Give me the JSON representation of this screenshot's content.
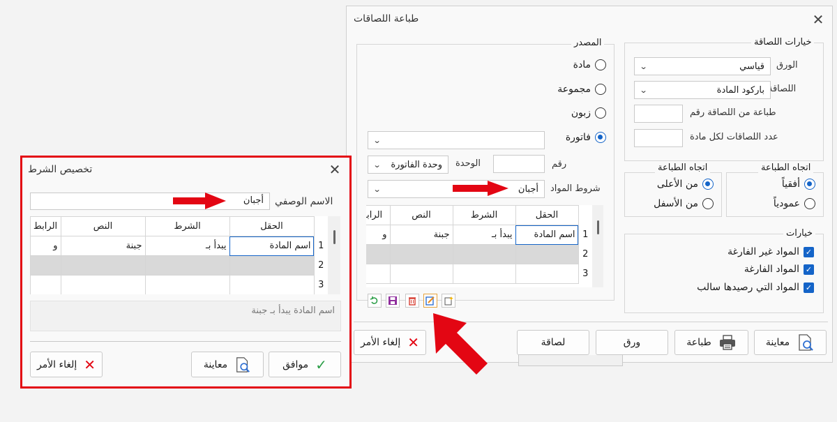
{
  "main": {
    "title": "طباعة اللصاقات",
    "options": {
      "legend": "خيارات اللصاقة",
      "paper_label": "الورق",
      "paper_value": "قياسي",
      "label_label": "اللصاقة",
      "label_value": "باركود المادة",
      "start_label": "طباعة من اللصاقة رقم",
      "count_label": "عدد اللصاقات لكل مادة"
    },
    "source": {
      "legend": "المصدر",
      "options": [
        "مادة",
        "مجموعة",
        "زبون",
        "فاتورة"
      ],
      "number_label": "رقم",
      "unit_label": "الوحدة",
      "unit_value": "وحدة الفاتورة",
      "conditions_label": "شروط المواد",
      "conditions_value": "أجبان"
    },
    "grid": {
      "headers": [
        "الحقل",
        "الشرط",
        "النص",
        "الرابط"
      ],
      "rows": [
        {
          "n": "1",
          "field": "اسم المادة",
          "cond": "يبدأ بـ",
          "text": "جبنة",
          "link": "و"
        },
        {
          "n": "2",
          "field": "",
          "cond": "",
          "text": "",
          "link": ""
        },
        {
          "n": "3",
          "field": "",
          "cond": "",
          "text": "",
          "link": ""
        }
      ]
    },
    "h_direction": {
      "legend": "اتجاه الطباعة",
      "options": [
        "أفقياً",
        "عمودياً"
      ]
    },
    "v_direction": {
      "legend": "اتجاه الطباعة",
      "options": [
        "من الأعلى",
        "من الأسفل"
      ]
    },
    "misc": {
      "legend": "خيارات",
      "options": [
        "المواد غير الفارغة",
        "المواد الفارغة",
        "المواد التي رصيدها سالب"
      ]
    },
    "buttons": {
      "preview": "معاينة",
      "print": "طباعة",
      "paper": "ورق",
      "label": "لصاقة",
      "cancel": "إلغاء الأمر"
    }
  },
  "dialog": {
    "title": "تخصيص الشرط",
    "desc_label": "الاسم الوصفي",
    "desc_value": "أجبان",
    "grid": {
      "headers": [
        "الحقل",
        "الشرط",
        "النص",
        "الرابط"
      ],
      "rows": [
        {
          "n": "1",
          "field": "اسم المادة",
          "cond": "يبدأ بـ",
          "text": "جبنة",
          "link": "و"
        },
        {
          "n": "2",
          "field": "",
          "cond": "",
          "text": "",
          "link": ""
        },
        {
          "n": "3",
          "field": "",
          "cond": "",
          "text": "",
          "link": ""
        }
      ]
    },
    "summary": "اسم المادة يبدأ بـ جبنة",
    "buttons": {
      "ok": "موافق",
      "preview": "معاينة",
      "cancel": "إلغاء الأمر"
    }
  },
  "colors": {
    "accent": "#1464c8",
    "highlight": "#e30613"
  }
}
